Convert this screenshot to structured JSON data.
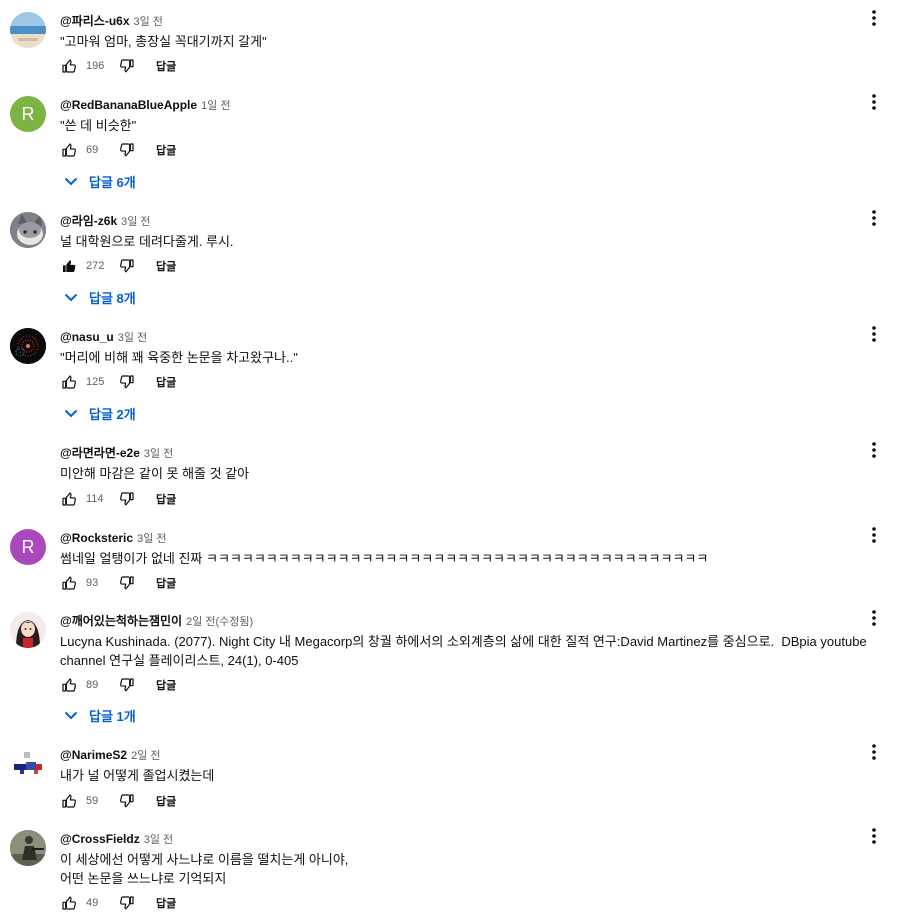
{
  "reply_label": "답글",
  "colors": {
    "link": "#065fd4",
    "meta": "#606060"
  },
  "comments": [
    {
      "author": "@파리스-u6x",
      "time": "3일 전",
      "text": "\"고마워 엄마, 총장실 꼭대기까지 갈게\"",
      "likes": "196",
      "liked": false,
      "avatar": {
        "type": "image",
        "name": "beach-avatar",
        "bg": "#bcd9e8"
      }
    },
    {
      "author": "@RedBananaBlueApple",
      "time": "1일 전",
      "text": "\"쓴 데 비슷한\"",
      "likes": "69",
      "liked": false,
      "replies": "답글 6개",
      "avatar": {
        "type": "letter",
        "letter": "R",
        "bg": "#7cb342"
      }
    },
    {
      "author": "@라임-z6k",
      "time": "3일 전",
      "text": "널 대학원으로 데려다줄게. 루시.",
      "likes": "272",
      "liked": true,
      "replies": "답글 8개",
      "avatar": {
        "type": "image",
        "name": "cat-avatar",
        "bg": "#8a8f99"
      }
    },
    {
      "author": "@nasu_u",
      "time": "3일 전",
      "text": "\"머리에 비해 꽤 육중한 논문을 차고왔구나..\"",
      "likes": "125",
      "liked": false,
      "replies": "답글 2개",
      "avatar": {
        "type": "image",
        "name": "fireworks-avatar",
        "bg": "#111111"
      }
    },
    {
      "author": "@라면라면-e2e",
      "time": "3일 전",
      "text": "미안해 마감은 같이 못 해줄 것 같아",
      "likes": "114",
      "liked": false,
      "avatar": {
        "type": "none"
      }
    },
    {
      "author": "@Rocksteric",
      "time": "3일 전",
      "text": "썸네일 얼탱이가 없네 진짜 ㅋㅋㅋㅋㅋㅋㅋㅋㅋㅋㅋㅋㅋㅋㅋㅋㅋㅋㅋㅋㅋㅋㅋㅋㅋㅋㅋㅋㅋㅋㅋㅋㅋㅋㅋㅋㅋㅋㅋㅋㅋㅋ",
      "likes": "93",
      "liked": false,
      "avatar": {
        "type": "letter",
        "letter": "R",
        "bg": "#ab47bc"
      }
    },
    {
      "author": "@깨어있는척하는잼민이",
      "time": "2일 전(수정됨)",
      "text": "Lucyna Kushinada. (2077). Night City 내 Megacorp의 창궐 하에서의 소외계층의 삶에 대한 질적 연구:David Martinez를 중심으로.  DBpia youtube channel 연구실 플레이리스트, 24(1), 0-405",
      "likes": "89",
      "liked": false,
      "replies": "답글 1개",
      "avatar": {
        "type": "image",
        "name": "anime-girl-avatar",
        "bg": "#f3e6e6"
      }
    },
    {
      "author": "@NarimeS2",
      "time": "2일 전",
      "text": "내가 널 어떻게 졸업시켰는데",
      "likes": "59",
      "liked": false,
      "avatar": {
        "type": "image",
        "name": "pixel-character-avatar",
        "bg": "#ffffff"
      }
    },
    {
      "author": "@CrossFieldz",
      "time": "3일 전",
      "text": "이 세상에선 어떻게 사느냐로 이름을 떨치는게 아니야,\n어떤 논문을 쓰느냐로 기억되지",
      "likes": "49",
      "liked": false,
      "avatar": {
        "type": "image",
        "name": "soldier-avatar",
        "bg": "#6b6f5a"
      }
    }
  ]
}
